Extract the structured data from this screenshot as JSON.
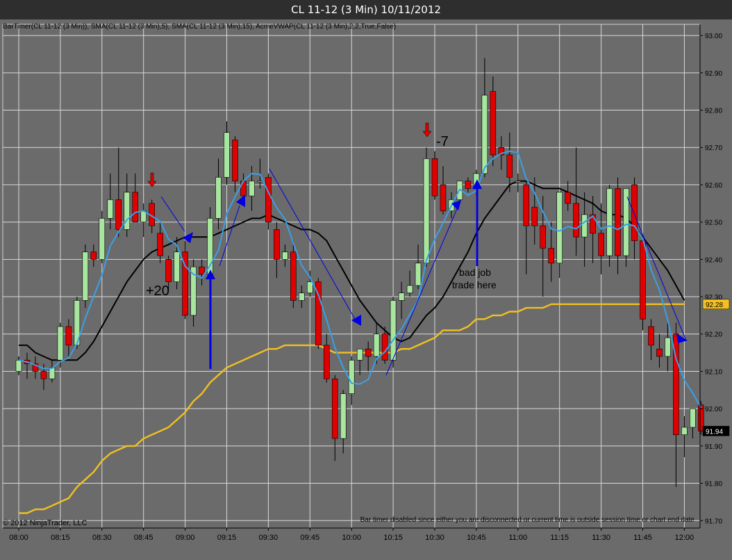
{
  "window": {
    "title": "CL 11-12 (3 Min)  10/11/2012"
  },
  "indicators_line": "BarTimer(CL 11-12 (3 Min)), SMA(CL 11-12 (3 Min),5), SMA(CL 11-12 (3 Min),15), AcmeVWAP(CL 11-12 (3 Min),2,2,True,False)",
  "footer": {
    "copyright": "© 2012 NinjaTrader, LLC",
    "bar_timer": "Bar timer disabled since either you are disconnected or current time is outside session time or chart end date"
  },
  "annotations": {
    "plus20": "+20",
    "minus7": "-7",
    "note_line1": "bad job",
    "note_line2": "trade here"
  },
  "colors": {
    "background": "#6b6b6b",
    "grid": "#d9d9d9",
    "up": "#a8e6a0",
    "down": "#e00000",
    "sma5": "#3aa0e8",
    "sma15": "#000000",
    "vwap": "#f2c020",
    "arrow": "#0000e0"
  },
  "chart_data": {
    "type": "candlestick",
    "title": "CL 11-12 (3 Min)  10/11/2012",
    "ylim": [
      91.68,
      93.03
    ],
    "y_ticks": [
      "93.00",
      "92.90",
      "92.80",
      "92.70",
      "92.60",
      "92.50",
      "92.40",
      "92.30",
      "92.20",
      "92.10",
      "92.00",
      "91.90",
      "91.80",
      "91.70"
    ],
    "x_ticks": [
      {
        "label": "08:00",
        "bar": 0
      },
      {
        "label": "08:15",
        "bar": 5
      },
      {
        "label": "08:30",
        "bar": 10
      },
      {
        "label": "08:45",
        "bar": 15
      },
      {
        "label": "09:00",
        "bar": 20
      },
      {
        "label": "09:15",
        "bar": 25
      },
      {
        "label": "09:30",
        "bar": 30
      },
      {
        "label": "09:45",
        "bar": 35
      },
      {
        "label": "10:00",
        "bar": 40
      },
      {
        "label": "10:15",
        "bar": 45
      },
      {
        "label": "10:30",
        "bar": 50
      },
      {
        "label": "10:45",
        "bar": 55
      },
      {
        "label": "11:00",
        "bar": 60
      },
      {
        "label": "11:15",
        "bar": 65
      },
      {
        "label": "11:30",
        "bar": 70
      },
      {
        "label": "11:45",
        "bar": 75
      },
      {
        "label": "12:00",
        "bar": 80
      }
    ],
    "bar_interval_min": 3,
    "ohlc": [
      [
        92.1,
        92.14,
        92.09,
        92.13
      ],
      [
        92.13,
        92.15,
        92.08,
        92.12
      ],
      [
        92.12,
        92.14,
        92.08,
        92.1
      ],
      [
        92.1,
        92.12,
        92.05,
        92.08
      ],
      [
        92.08,
        92.13,
        92.07,
        92.11
      ],
      [
        92.13,
        92.23,
        92.11,
        92.22
      ],
      [
        92.22,
        92.24,
        92.14,
        92.17
      ],
      [
        92.17,
        92.3,
        92.16,
        92.29
      ],
      [
        92.29,
        92.44,
        92.27,
        92.42
      ],
      [
        92.42,
        92.44,
        92.38,
        92.4
      ],
      [
        92.4,
        92.53,
        92.39,
        92.51
      ],
      [
        92.51,
        92.63,
        92.48,
        92.56
      ],
      [
        92.56,
        92.7,
        92.46,
        92.48
      ],
      [
        92.48,
        92.63,
        92.46,
        92.58
      ],
      [
        92.58,
        92.63,
        92.5,
        92.5
      ],
      [
        92.5,
        92.55,
        92.46,
        92.53
      ],
      [
        92.55,
        92.56,
        92.47,
        92.49
      ],
      [
        92.47,
        92.5,
        92.39,
        92.41
      ],
      [
        92.4,
        92.41,
        92.32,
        92.34
      ],
      [
        92.34,
        92.46,
        92.32,
        92.42
      ],
      [
        92.42,
        92.45,
        92.24,
        92.25
      ],
      [
        92.25,
        92.4,
        92.22,
        92.38
      ],
      [
        92.38,
        92.4,
        92.33,
        92.36
      ],
      [
        92.36,
        92.54,
        92.34,
        92.51
      ],
      [
        92.51,
        92.67,
        92.48,
        92.62
      ],
      [
        92.62,
        92.77,
        92.6,
        92.74
      ],
      [
        92.72,
        92.73,
        92.58,
        92.61
      ],
      [
        92.61,
        92.63,
        92.55,
        92.57
      ],
      [
        92.57,
        92.65,
        92.53,
        92.61
      ],
      [
        92.61,
        92.67,
        92.59,
        92.61
      ],
      [
        92.62,
        92.63,
        92.48,
        92.5
      ],
      [
        92.48,
        92.5,
        92.35,
        92.4
      ],
      [
        92.4,
        92.44,
        92.38,
        92.42
      ],
      [
        92.42,
        92.45,
        92.27,
        92.29
      ],
      [
        92.29,
        92.33,
        92.27,
        92.31
      ],
      [
        92.31,
        92.37,
        92.3,
        92.34
      ],
      [
        92.34,
        92.35,
        92.16,
        92.17
      ],
      [
        92.17,
        92.2,
        92.07,
        92.08
      ],
      [
        92.08,
        92.09,
        91.86,
        91.92
      ],
      [
        91.92,
        92.05,
        91.88,
        92.04
      ],
      [
        92.04,
        92.14,
        92.01,
        92.13
      ],
      [
        92.13,
        92.16,
        92.09,
        92.16
      ],
      [
        92.16,
        92.18,
        92.1,
        92.14
      ],
      [
        92.14,
        92.23,
        92.12,
        92.2
      ],
      [
        92.2,
        92.22,
        92.12,
        92.13
      ],
      [
        92.13,
        92.3,
        92.11,
        92.29
      ],
      [
        92.29,
        92.34,
        92.24,
        92.31
      ],
      [
        92.31,
        92.37,
        92.3,
        92.33
      ],
      [
        92.33,
        92.44,
        92.32,
        92.39
      ],
      [
        92.39,
        92.7,
        92.38,
        92.67
      ],
      [
        92.67,
        92.69,
        92.56,
        92.57
      ],
      [
        92.6,
        92.65,
        92.52,
        92.53
      ],
      [
        92.53,
        92.58,
        92.51,
        92.56
      ],
      [
        92.56,
        92.61,
        92.55,
        92.61
      ],
      [
        92.61,
        92.62,
        92.58,
        92.59
      ],
      [
        92.59,
        92.64,
        92.57,
        92.63
      ],
      [
        92.63,
        92.94,
        92.62,
        92.84
      ],
      [
        92.85,
        92.89,
        92.65,
        92.68
      ],
      [
        92.7,
        92.73,
        92.64,
        92.68
      ],
      [
        92.68,
        92.74,
        92.58,
        92.62
      ],
      [
        92.61,
        92.63,
        92.58,
        92.61
      ],
      [
        92.6,
        92.61,
        92.36,
        92.49
      ],
      [
        92.54,
        92.62,
        92.44,
        92.49
      ],
      [
        92.49,
        92.57,
        92.3,
        92.43
      ],
      [
        92.43,
        92.5,
        92.34,
        92.39
      ],
      [
        92.39,
        92.55,
        92.35,
        92.58
      ],
      [
        92.58,
        92.61,
        92.53,
        92.55
      ],
      [
        92.55,
        92.7,
        92.41,
        92.46
      ],
      [
        92.46,
        92.58,
        92.38,
        92.52
      ],
      [
        92.52,
        92.57,
        92.39,
        92.47
      ],
      [
        92.47,
        92.55,
        92.36,
        92.41
      ],
      [
        92.41,
        92.6,
        92.38,
        92.59
      ],
      [
        92.59,
        92.62,
        92.36,
        92.41
      ],
      [
        92.41,
        92.58,
        92.38,
        92.59
      ],
      [
        92.6,
        92.62,
        92.4,
        92.45
      ],
      [
        92.45,
        92.46,
        92.21,
        92.24
      ],
      [
        92.22,
        92.24,
        92.13,
        92.17
      ],
      [
        92.16,
        92.2,
        92.11,
        92.14
      ],
      [
        92.14,
        92.23,
        92.1,
        92.19
      ],
      [
        92.2,
        92.23,
        91.79,
        91.93
      ],
      [
        91.93,
        91.98,
        91.87,
        91.95
      ],
      [
        91.95,
        92.0,
        91.92,
        92.0
      ],
      [
        92.01,
        92.02,
        91.93,
        91.94
      ]
    ],
    "sma15": [
      92.17,
      92.17,
      92.15,
      92.14,
      92.13,
      92.13,
      92.13,
      92.13,
      92.15,
      92.18,
      92.22,
      92.26,
      92.3,
      92.34,
      92.37,
      92.4,
      92.42,
      92.43,
      92.44,
      92.45,
      92.46,
      92.46,
      92.46,
      92.46,
      92.47,
      92.48,
      92.49,
      92.5,
      92.51,
      92.51,
      92.52,
      92.51,
      92.5,
      92.49,
      92.48,
      92.48,
      92.47,
      92.45,
      92.41,
      92.37,
      92.33,
      92.29,
      92.26,
      92.23,
      92.21,
      92.19,
      92.18,
      92.19,
      92.22,
      92.25,
      92.27,
      92.3,
      92.34,
      92.38,
      92.42,
      92.47,
      92.51,
      92.54,
      92.57,
      92.6,
      92.61,
      92.61,
      92.6,
      92.59,
      92.59,
      92.59,
      92.58,
      92.57,
      92.56,
      92.55,
      92.53,
      92.52,
      92.52,
      92.51,
      92.49,
      92.46,
      92.43,
      92.4,
      92.37,
      92.33,
      92.29
    ],
    "vwap": [
      91.72,
      91.72,
      91.73,
      91.73,
      91.74,
      91.75,
      91.76,
      91.79,
      91.81,
      91.83,
      91.86,
      91.88,
      91.89,
      91.9,
      91.9,
      91.92,
      91.93,
      91.94,
      91.95,
      91.97,
      91.99,
      92.02,
      92.04,
      92.07,
      92.09,
      92.11,
      92.12,
      92.13,
      92.14,
      92.15,
      92.16,
      92.16,
      92.17,
      92.17,
      92.17,
      92.17,
      92.17,
      92.16,
      92.15,
      92.15,
      92.15,
      92.15,
      92.15,
      92.15,
      92.15,
      92.15,
      92.16,
      92.16,
      92.17,
      92.18,
      92.19,
      92.21,
      92.21,
      92.21,
      92.22,
      92.24,
      92.24,
      92.25,
      92.25,
      92.26,
      92.26,
      92.27,
      92.27,
      92.27,
      92.28,
      92.28,
      92.28,
      92.28,
      92.28,
      92.28,
      92.28,
      92.28,
      92.28,
      92.28,
      92.28,
      92.28,
      92.28,
      92.28,
      92.28,
      92.28,
      92.28
    ],
    "annotations": [
      {
        "type": "label",
        "text": "+20",
        "bar": 21.5,
        "y": 92.29
      },
      {
        "type": "label",
        "text": "-7",
        "bar": 50.5,
        "y": 92.69
      },
      {
        "type": "label",
        "text": "bad job",
        "bar": 55,
        "y": 92.42
      },
      {
        "type": "label",
        "text": "trade here",
        "bar": 55,
        "y": 92.38
      }
    ],
    "last_price_label": "91.94",
    "vwap_price_label": "92.28"
  }
}
